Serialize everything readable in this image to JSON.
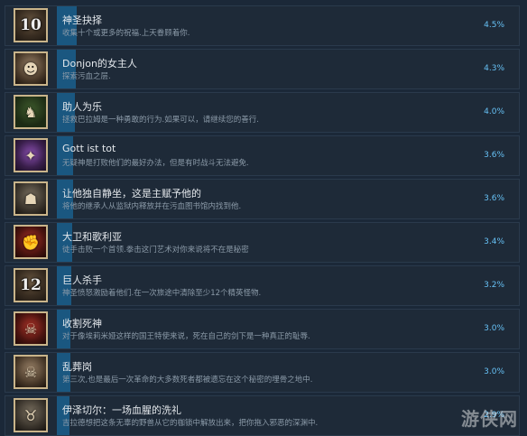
{
  "achievements": [
    {
      "title": "神圣抉择",
      "desc": "收集十个或更多的祝福.上天眷顾着你.",
      "percent": "4.5%",
      "percent_value": 4.5,
      "icon": "number-10-icon",
      "icon_label": "10",
      "icon_style": ""
    },
    {
      "title": "Donjon的女主人",
      "desc": "探索污血之层.",
      "percent": "4.3%",
      "percent_value": 4.3,
      "icon": "mistress-portrait-icon",
      "icon_label": "",
      "icon_style": "skull"
    },
    {
      "title": "助人为乐",
      "desc": "拯救巴拉姆是一种勇敢的行为.如果可以，请继续您的善行.",
      "percent": "4.0%",
      "percent_value": 4.0,
      "icon": "hooded-figure-icon",
      "icon_label": "",
      "icon_style": "green"
    },
    {
      "title": "Gott ist tot",
      "desc": "无疑神是打败他们的最好办法，但是有时战斗无法避免.",
      "percent": "3.6%",
      "percent_value": 3.6,
      "icon": "purple-demon-icon",
      "icon_label": "",
      "icon_style": "purple"
    },
    {
      "title": "让他独自静坐，这是主赋予他的",
      "desc": "将他的继承人从监狱内释放并在污血图书馆内找到他.",
      "percent": "3.6%",
      "percent_value": 3.6,
      "icon": "prisoner-icon",
      "icon_label": "",
      "icon_style": "gray"
    },
    {
      "title": "大卫和歌利亚",
      "desc": "徒手击败一个首领.拳击这门艺术对你来说将不在是秘密",
      "percent": "3.4%",
      "percent_value": 3.4,
      "icon": "fist-icon",
      "icon_label": "",
      "icon_style": "red"
    },
    {
      "title": "巨人杀手",
      "desc": "神圣愤怒激励着他们.在一次旅途中清除至少12个精英怪物.",
      "percent": "3.2%",
      "percent_value": 3.2,
      "icon": "number-12-icon",
      "icon_label": "12",
      "icon_style": ""
    },
    {
      "title": "收割死神",
      "desc": "对于像埃莉米娅这样的国王特使来说，死在自己的剑下是一种真正的耻辱.",
      "percent": "3.0%",
      "percent_value": 3.0,
      "icon": "reaper-icon",
      "icon_label": "",
      "icon_style": "red"
    },
    {
      "title": "乱葬岗",
      "desc": "第三次,也是最后一次革命的大多数死者都被遗忘在这个秘密的埋骨之地中.",
      "percent": "3.0%",
      "percent_value": 3.0,
      "icon": "skull-pile-icon",
      "icon_label": "",
      "icon_style": "skull"
    },
    {
      "title": "伊泽切尔：一场血腥的洗礼",
      "desc": "吉拉德想把这条无辜的野兽从它的枷锁中解放出来，把你拖入邪恶的深渊中.",
      "percent": "2.9%",
      "percent_value": 2.9,
      "icon": "beast-icon",
      "icon_label": "",
      "icon_style": "gray"
    }
  ],
  "watermark": "游侠网"
}
